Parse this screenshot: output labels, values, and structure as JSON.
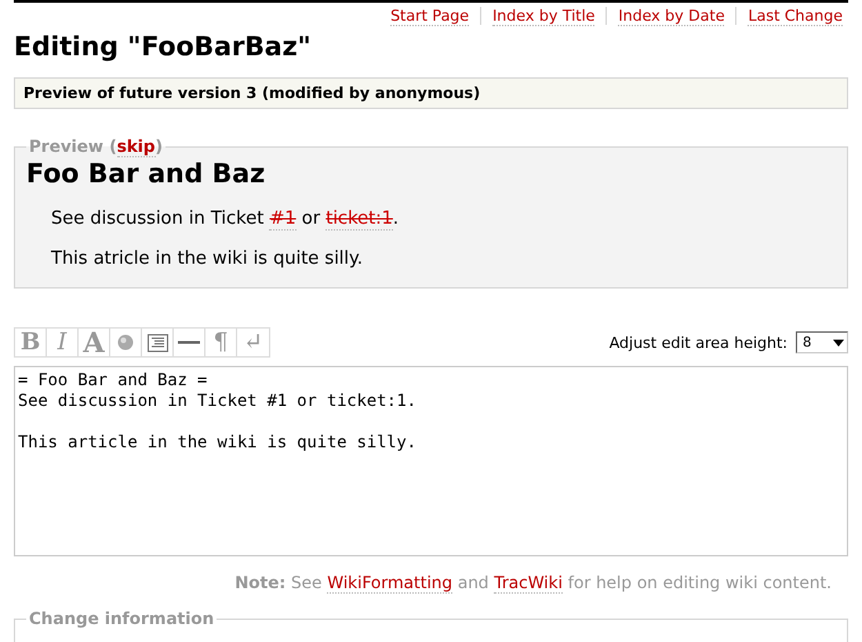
{
  "nav": [
    "Start Page",
    "Index by Title",
    "Index by Date",
    "Last Change"
  ],
  "title": "Editing \"FooBarBaz\"",
  "version_note": "Preview of future version 3 (modified by anonymous)",
  "preview": {
    "legend": "Preview",
    "paren_open": "(",
    "skip_link": "skip",
    "paren_close": ")",
    "heading": "Foo Bar and Baz",
    "paragraphs": [
      [
        {
          "kind": "text",
          "text": "See discussion in Ticket "
        },
        {
          "kind": "missing_link",
          "text": "#1"
        },
        {
          "kind": "text",
          "text": " or "
        },
        {
          "kind": "missing_link",
          "text": "ticket:1"
        },
        {
          "kind": "text",
          "text": "."
        }
      ],
      [
        {
          "kind": "text",
          "text": "This atricle in the wiki is quite silly."
        }
      ]
    ]
  },
  "toolbar": [
    {
      "kind": "bold",
      "label": "B"
    },
    {
      "kind": "italic",
      "label": "I"
    },
    {
      "kind": "heading",
      "label": "A"
    },
    {
      "kind": "globe"
    },
    {
      "kind": "code"
    },
    {
      "kind": "rule"
    },
    {
      "kind": "text",
      "label": "¶"
    },
    {
      "kind": "text",
      "label": "↵"
    }
  ],
  "height_label": "Adjust edit area height:",
  "height_value": "8",
  "editor_text": "= Foo Bar and Baz =\nSee discussion in Ticket #1 or ticket:1.\n\nThis article in the wiki is quite silly.",
  "note": {
    "label": "Note:",
    "before": "See",
    "link1": "WikiFormatting",
    "between": "and",
    "link2": "TracWiki",
    "after": "for help on editing wiki content."
  },
  "change_legend": "Change information"
}
